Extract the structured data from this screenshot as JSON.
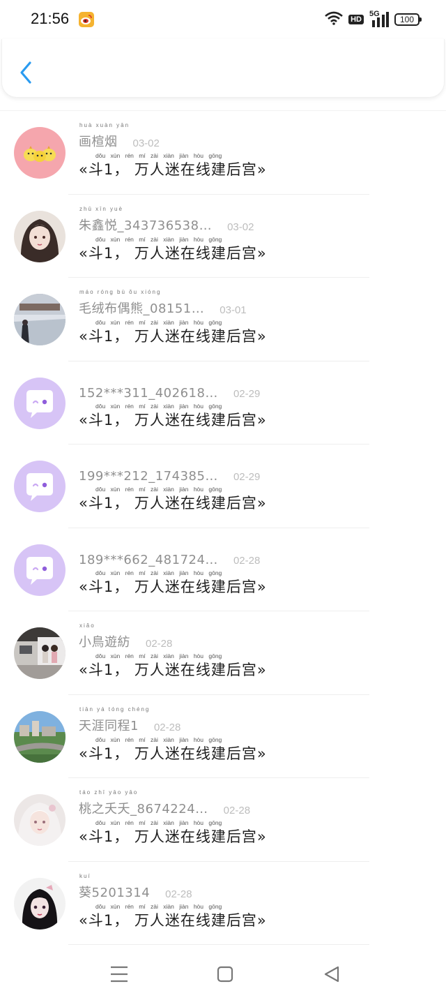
{
  "status_bar": {
    "time": "21:56",
    "hd": "HD",
    "network": "5G",
    "battery": "100"
  },
  "messages": [
    {
      "name": "画楦烟",
      "name_pinyin": "huà xuàn yān",
      "date": "03-02",
      "text": "«斗1， 万人迷在线建后宫»",
      "avatar": "chicks"
    },
    {
      "name": "朱鑫悦_343736538…",
      "name_pinyin": "zhū xīn yuè",
      "date": "03-02",
      "text": "«斗1， 万人迷在线建后宫»",
      "avatar": "anime-girl"
    },
    {
      "name": "毛绒布偶熊_08151…",
      "name_pinyin": "máo róng bù ǒu xióng",
      "date": "03-01",
      "text": "«斗1， 万人迷在线建后宫»",
      "avatar": "snow-photo"
    },
    {
      "name": "152***311_402618…",
      "name_pinyin": "",
      "date": "02-29",
      "text": "«斗1， 万人迷在线建后宫»",
      "avatar": "default"
    },
    {
      "name": "199***212_174385…",
      "name_pinyin": "",
      "date": "02-29",
      "text": "«斗1， 万人迷在线建后宫»",
      "avatar": "default"
    },
    {
      "name": "189***662_481724…",
      "name_pinyin": "",
      "date": "02-28",
      "text": "«斗1， 万人迷在线建后宫»",
      "avatar": "default"
    },
    {
      "name": "小鳥遊紡",
      "name_pinyin": "xiǎo",
      "date": "02-28",
      "text": "«斗1， 万人迷在线建后宫»",
      "avatar": "group-photo"
    },
    {
      "name": "天涯同程1",
      "name_pinyin": "tiān yá tóng chéng",
      "date": "02-28",
      "text": "«斗1， 万人迷在线建后宫»",
      "avatar": "city-photo"
    },
    {
      "name": "桃之夭夭_8674224…",
      "name_pinyin": "táo zhī yāo yāo",
      "date": "02-28",
      "text": "«斗1， 万人迷在线建后宫»",
      "avatar": "white-hair-girl"
    },
    {
      "name": "葵5201314",
      "name_pinyin": "kuí",
      "date": "02-28",
      "text": "«斗1， 万人迷在线建后宫»",
      "avatar": "dark-girl"
    }
  ],
  "message_pinyin": "dǒu   xùn rén mí zài xiàn jiàn hòu gōng",
  "colors": {
    "accent": "#2a9bf0",
    "default_avatar": "#d7c4f6",
    "chick_avatar_bg": "#f5a6ad"
  }
}
